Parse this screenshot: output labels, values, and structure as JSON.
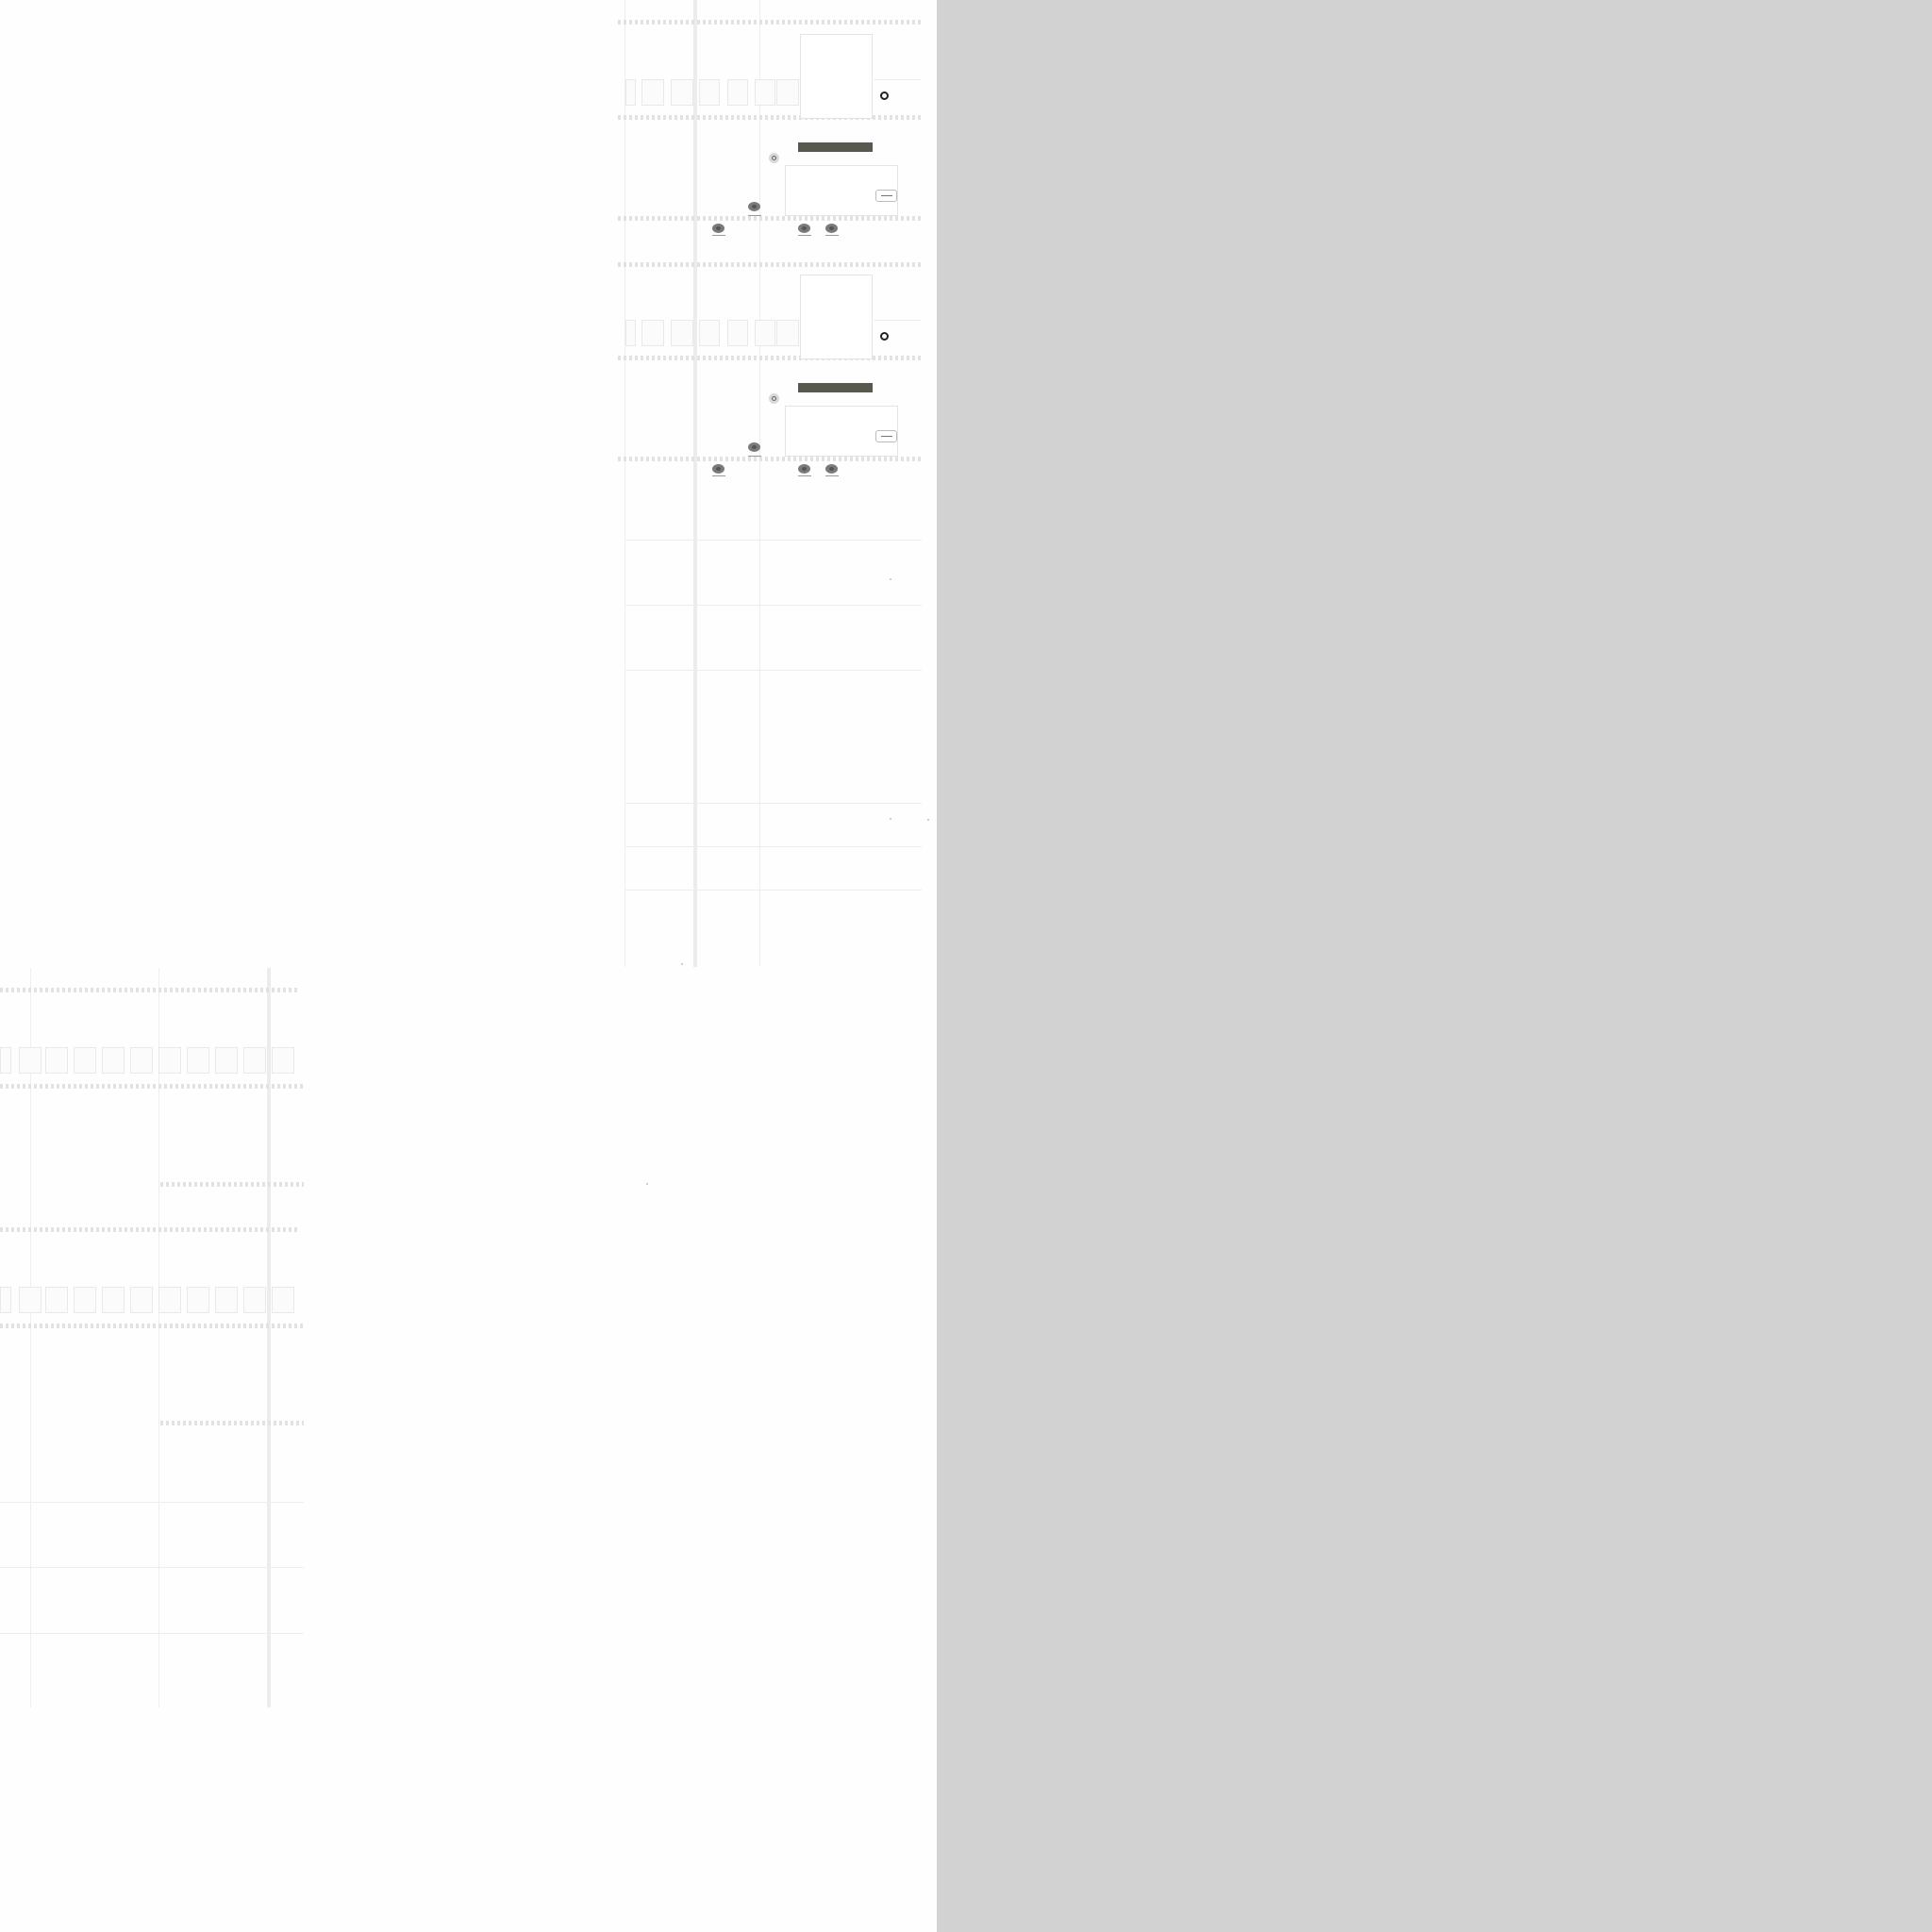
{
  "app": {
    "title": ""
  },
  "colors": {
    "canvas": "#fefefe",
    "side_panel": "#d2d2d2",
    "accent_bar": "#58594e",
    "node_fill": "#7a7a7a",
    "gridline": "#eeeeee"
  },
  "icons": [
    "gear-icon",
    "radio-ring-icon",
    "node-dot-icon"
  ],
  "flows": [
    {
      "name": "",
      "nodes": 4
    },
    {
      "name": "",
      "nodes": 4
    }
  ]
}
